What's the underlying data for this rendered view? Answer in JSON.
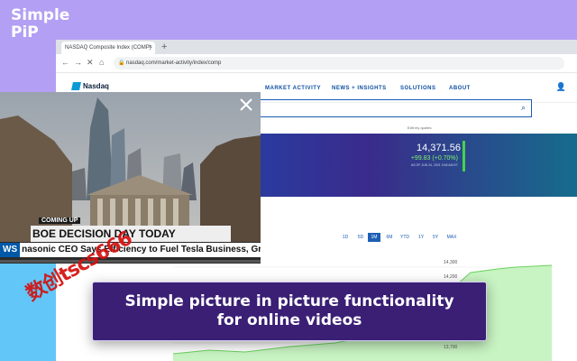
{
  "brand": {
    "line1": "Simple",
    "line2": "PiP"
  },
  "browser": {
    "tab_title": "NASDAQ Composite Index (COMP)",
    "tab_close": "×",
    "new_tab": "+",
    "url": "nasdaq.com/market-activity/index/comp",
    "nav_back": "←",
    "nav_forward": "→",
    "nav_reload": "✕",
    "nav_home": "⌂"
  },
  "site": {
    "logo": "Nasdaq",
    "nav": [
      "MARKET ACTIVITY",
      "NEWS + INSIGHTS",
      "SOLUTIONS",
      "ABOUT"
    ],
    "edit_quotes": "Edit my quotes",
    "quote": {
      "value": "14,371.56",
      "change": "+99.83 (+0.70%)",
      "date": "AS OF JUN 24, 2021 9:46 AM ET"
    },
    "ranges": [
      "1D",
      "5D",
      "1M",
      "6M",
      "YTD",
      "1Y",
      "5Y",
      "MAX"
    ],
    "active_range": "1M",
    "axis_labels": [
      "14,300",
      "14,200",
      "13,700"
    ]
  },
  "video": {
    "coming_up": "COMING UP",
    "headline": "BOE DECISION DAY TODAY",
    "ticker_tag": "WS",
    "ticker": "nasonic CEO Says Efficiency to Fuel Tesla Business, Growth",
    "progress": 0.0
  },
  "watermark": "数创tscs666",
  "caption": {
    "line1": "Simple picture in picture functionality",
    "line2": "for online videos"
  },
  "colors": {
    "bg": "#b39ff3",
    "caption_bg": "#3a1f75",
    "nasdaq_blue": "#1e5fb4",
    "gain_green": "#7cf36f"
  }
}
